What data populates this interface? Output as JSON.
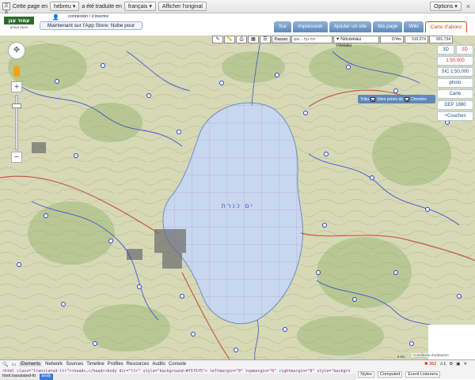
{
  "translate_bar": {
    "prefix": "Cette page en",
    "source_lang": "hébreu",
    "middle": "a été traduite en",
    "target_lang": "français",
    "show_original": "Afficher l'original",
    "options": "Options",
    "close": "×"
  },
  "header": {
    "logo_text": "עמוד ענן",
    "logo_sub": "amud anan",
    "login": "connexion / s'inscrire",
    "app_banner": "Maintenant sur l'App Store: Nube pour",
    "tabs": [
      "Sur",
      "impression",
      "Ajouter un site",
      "Ma page",
      "Wiki",
      "Carte d'abord"
    ],
    "active_tab": "Carte d'abord"
  },
  "map_toolbar": {
    "pass_label": "Passer",
    "search_placeholder": "יפה נוף ...שם",
    "level_label": "Nouveau niveau",
    "altitude": "374m",
    "coord_x": "310.274",
    "coord_y": "901.734"
  },
  "side_panel": {
    "btn_3d": "3D",
    "btn_2d": "2D",
    "scale_50k": "1:50,000",
    "scale_100k": "SIC 1:50,000",
    "photo": "photo",
    "map": "Carte",
    "dep": "DEP 1880",
    "layers": "+Couches"
  },
  "layers_box": {
    "label": "Tribu",
    "opt1": "Sites points de",
    "opt2": "Chemins"
  },
  "map": {
    "lake_label": "ים כנרת",
    "credit": "Conditions d'utilisation",
    "scale": "5 km"
  },
  "devtools": {
    "tabs": [
      "Elements",
      "Network",
      "Sources",
      "Timeline",
      "Profiles",
      "Resources",
      "Audits",
      "Console"
    ],
    "active_tab": "Elements",
    "code": "<html class=\"translated-ltr\"><head>…</head><body dir=\"ltr\" style=\"background:#f5f5f5\"> leftmargin=\"0\" topmargin=\"0\" rightmargin=\"0\" style=\"background-color: #ffffff; overflow: hidden;\">",
    "breadcrumb": [
      "html.translated-ltr",
      "body"
    ],
    "selected_crumb": "body",
    "right_tabs": [
      "Styles",
      "Computed",
      "Event Listeners"
    ],
    "errors": "362",
    "warnings": "⚠1"
  },
  "colors": {
    "lake": "#c8d6ee",
    "terrain": "#cfd7b5",
    "accent": "#c84a1a",
    "nav_tab": "#6a94c4"
  }
}
